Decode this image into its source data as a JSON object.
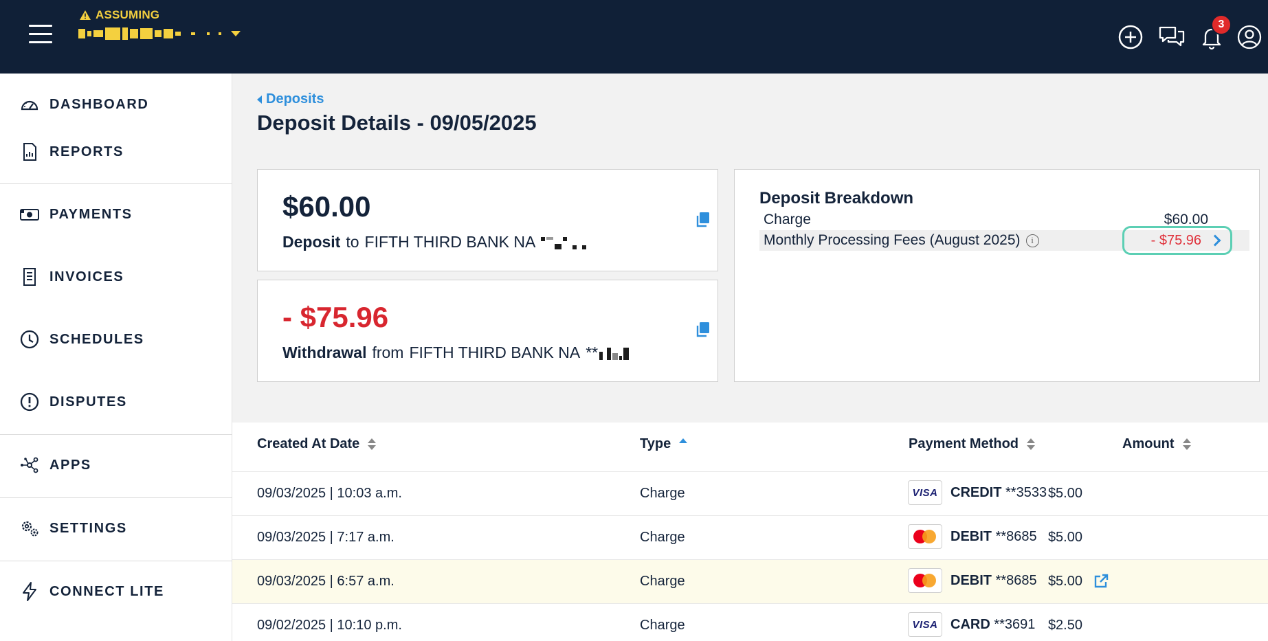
{
  "topbar": {
    "assuming_label": "ASSUMING",
    "account_name_redacted": true,
    "notification_count": "3",
    "icons": [
      "menu-icon",
      "warning-icon",
      "add-icon",
      "chat-icon",
      "bell-icon",
      "account-icon"
    ]
  },
  "sidebar": {
    "items": [
      {
        "label": "DASHBOARD",
        "icon": "gauge-icon"
      },
      {
        "label": "REPORTS",
        "icon": "report-icon"
      },
      {
        "label": "PAYMENTS",
        "icon": "cash-icon"
      },
      {
        "label": "INVOICES",
        "icon": "invoice-icon"
      },
      {
        "label": "SCHEDULES",
        "icon": "clock-icon"
      },
      {
        "label": "DISPUTES",
        "icon": "alert-icon"
      },
      {
        "label": "APPS",
        "icon": "apps-network-icon"
      },
      {
        "label": "SETTINGS",
        "icon": "gears-icon"
      },
      {
        "label": "CONNECT LITE",
        "icon": "bolt-icon"
      }
    ]
  },
  "breadcrumb": {
    "label": "Deposits"
  },
  "page": {
    "title": "Deposit Details - 09/05/2025"
  },
  "deposit_card": {
    "amount": "$60.00",
    "type_label": "Deposit",
    "direction": "to",
    "bank": "FIFTH THIRD BANK NA"
  },
  "withdrawal_card": {
    "amount": "- $75.96",
    "type_label": "Withdrawal",
    "direction": "from",
    "bank": "FIFTH THIRD BANK NA",
    "mask_prefix": "**"
  },
  "breakdown": {
    "title": "Deposit Breakdown",
    "rows": [
      {
        "label": "Charge",
        "value": "$60.00"
      },
      {
        "label": "Monthly Processing Fees (August 2025)",
        "value": "- $75.96"
      }
    ],
    "colors": {
      "negative": "#e0303a",
      "highlight_border": "#5ccfb4"
    }
  },
  "table": {
    "columns": [
      "Created At Date",
      "Type",
      "Payment Method",
      "Amount"
    ],
    "sorted_column": "Type",
    "rows": [
      {
        "date": "09/03/2025 | 10:03 a.m.",
        "type": "Charge",
        "brand": "VISA",
        "method": "CREDIT",
        "last4": "**3533",
        "amount": "$5.00"
      },
      {
        "date": "09/03/2025 | 7:17 a.m.",
        "type": "Charge",
        "brand": "mastercard",
        "method": "DEBIT",
        "last4": "**8685",
        "amount": "$5.00"
      },
      {
        "date": "09/03/2025 | 6:57 a.m.",
        "type": "Charge",
        "brand": "mastercard",
        "method": "DEBIT",
        "last4": "**8685",
        "amount": "$5.00"
      },
      {
        "date": "09/02/2025 | 10:10 p.m.",
        "type": "Charge",
        "brand": "VISA",
        "method": "CARD",
        "last4": "**3691",
        "amount": "$2.50"
      }
    ]
  },
  "colors": {
    "topbar": "#102037",
    "accent": "#2e8fdc",
    "warning": "#f4d03f",
    "badge": "#e02a2a"
  }
}
